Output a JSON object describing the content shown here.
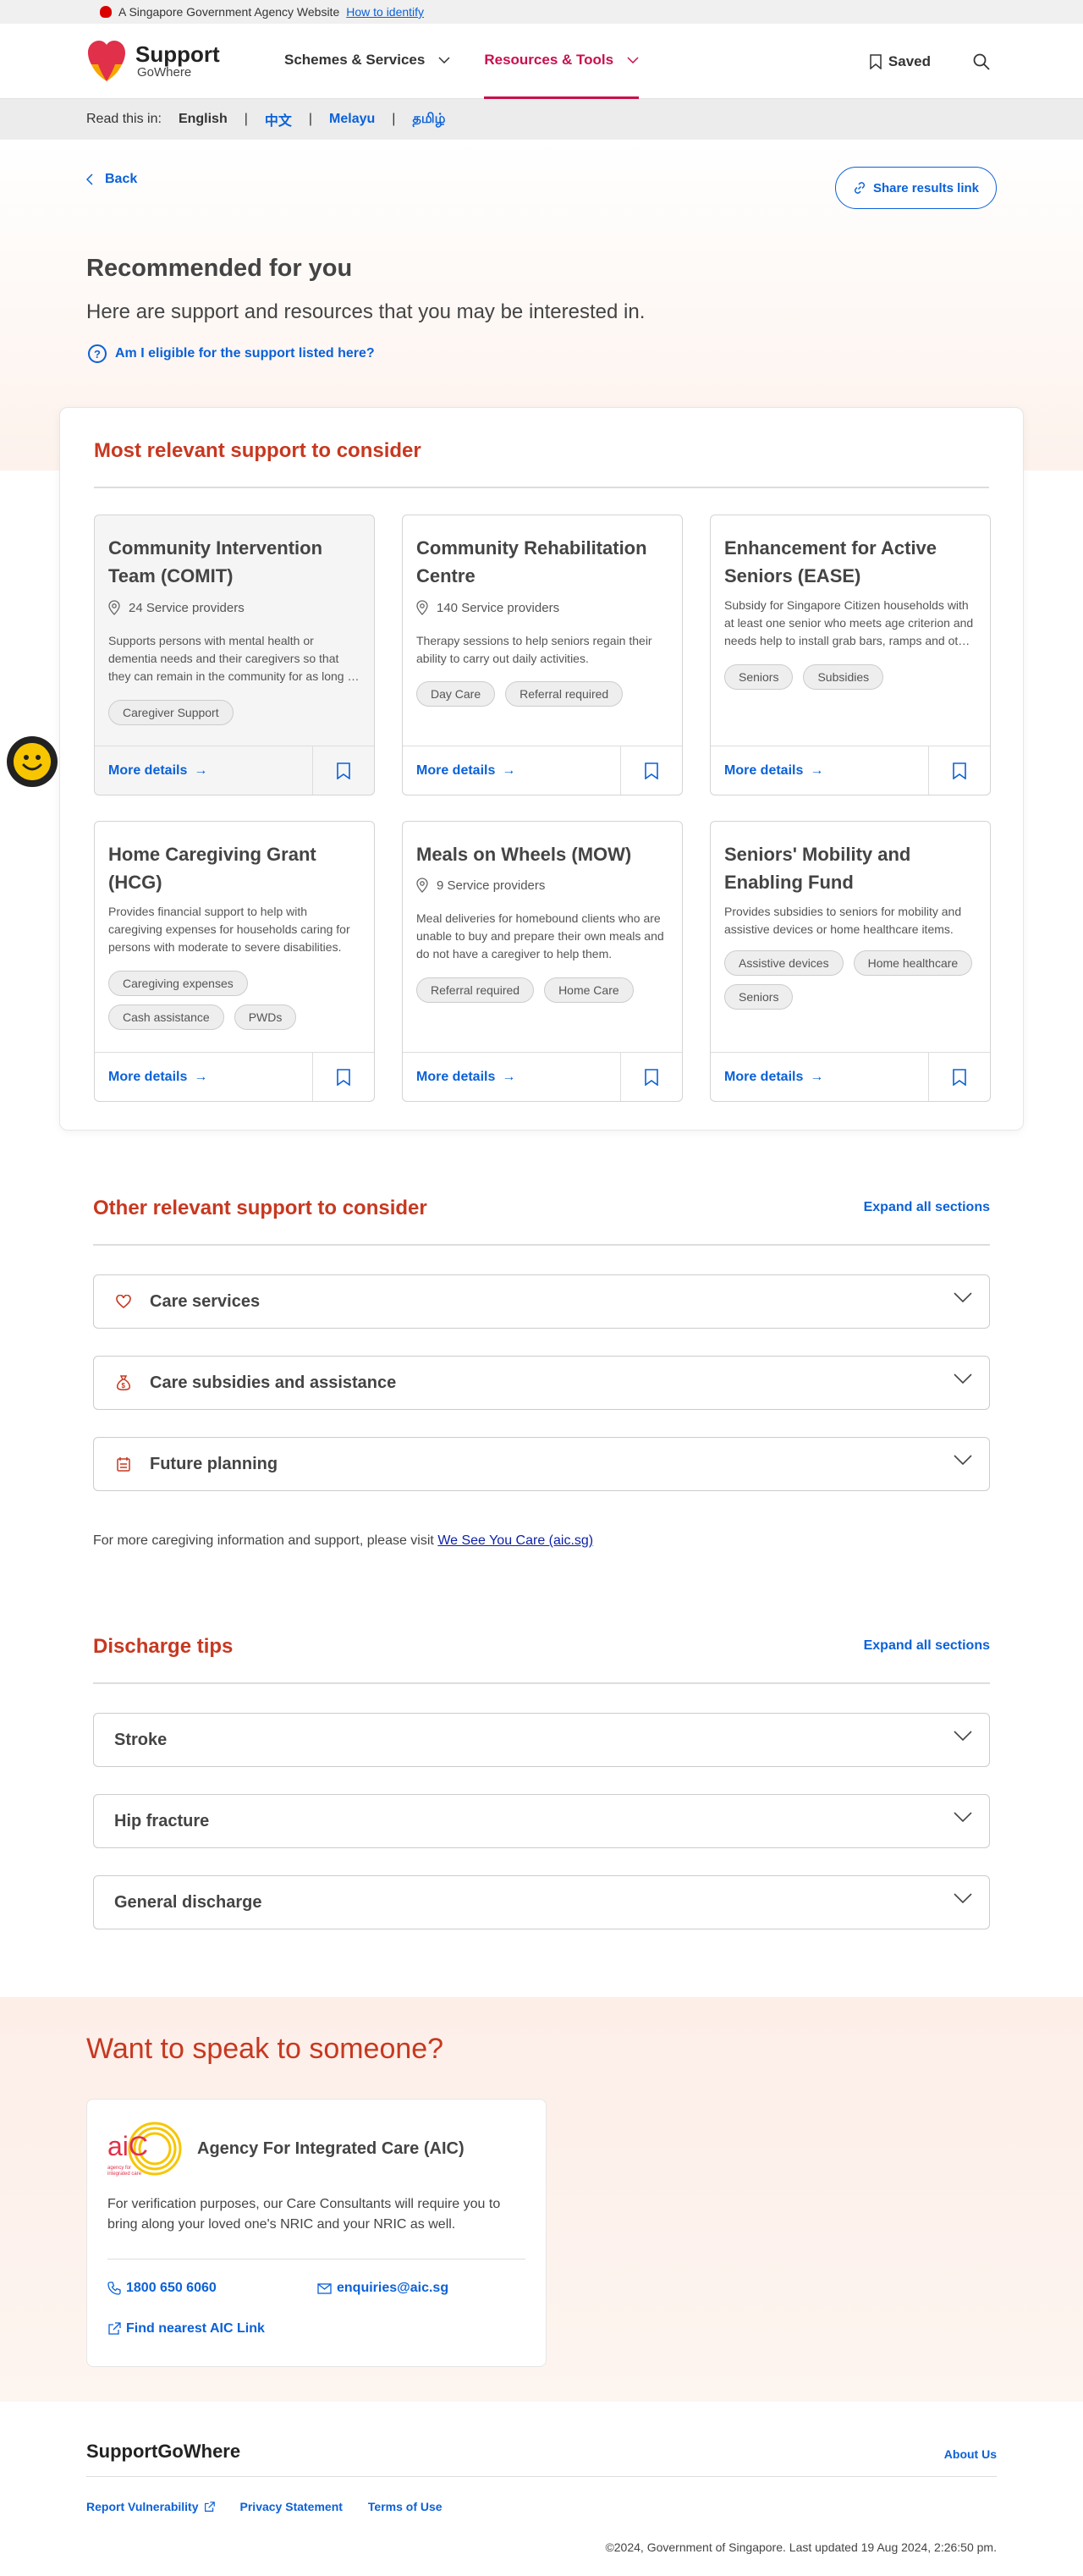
{
  "gov_banner": {
    "text": "A Singapore Government Agency Website",
    "link": "How to identify"
  },
  "logo": {
    "line1": "Support",
    "line2": "GoWhere"
  },
  "nav": [
    {
      "label": "Schemes & Services"
    },
    {
      "label": "Resources & Tools"
    }
  ],
  "header_right": {
    "saved": "Saved"
  },
  "lang": {
    "label": "Read this in:",
    "options": [
      "English",
      "中文",
      "Melayu",
      "தமிழ்"
    ]
  },
  "hero": {
    "back": "Back",
    "share": "Share results link",
    "title": "Recommended for you",
    "subtitle": "Here are support and resources that you may be interested in.",
    "eligibility": "Am I eligible for the support listed here?"
  },
  "most_relevant": {
    "title": "Most relevant support to consider",
    "cards": [
      {
        "title": "Community Intervention Team (COMIT)",
        "providers": "24 Service providers",
        "desc": "Supports persons with mental health or dementia needs and their caregivers so that they can remain in the community for as long as possible.",
        "tags": [
          "Caregiver Support"
        ],
        "more": "More details"
      },
      {
        "title": "Community Rehabilitation Centre",
        "providers": "140 Service providers",
        "desc": "Therapy sessions to help seniors regain their ability to carry out daily activities.",
        "tags": [
          "Day Care",
          "Referral required"
        ],
        "more": "More details"
      },
      {
        "title": "Enhancement for Active Seniors (EASE)",
        "providers": "",
        "desc": "Subsidy for Singapore Citizen households with at least one senior who meets age criterion and needs help to install grab bars, ramps and other home fittings.",
        "tags": [
          "Seniors",
          "Subsidies"
        ],
        "more": "More details"
      },
      {
        "title": "Home Caregiving Grant (HCG)",
        "providers": "",
        "desc": "Provides financial support to help with caregiving expenses for households caring for persons with moderate to severe disabilities.",
        "tags": [
          "Caregiving expenses",
          "Cash assistance",
          "PWDs"
        ],
        "more": "More details"
      },
      {
        "title": "Meals on Wheels (MOW)",
        "providers": "9 Service providers",
        "desc": "Meal deliveries for homebound clients who are unable to buy and prepare their own meals and do not have a caregiver to help them.",
        "tags": [
          "Referral required",
          "Home Care"
        ],
        "more": "More details"
      },
      {
        "title": "Seniors' Mobility and Enabling Fund",
        "providers": "",
        "desc": "Provides subsidies to seniors for mobility and assistive devices or home healthcare items.",
        "tags": [
          "Assistive devices",
          "Home healthcare",
          "Seniors"
        ],
        "more": "More details"
      }
    ]
  },
  "other_relevant": {
    "title": "Other relevant support to consider",
    "expand": "Expand all sections",
    "sections": [
      "Care services",
      "Care subsidies and assistance",
      "Future planning"
    ]
  },
  "visit": {
    "text": "For more caregiving information and support, please visit ",
    "link": "We See You Care (aic.sg)"
  },
  "discharge": {
    "title": "Discharge tips",
    "expand": "Expand all sections",
    "sections": [
      "Stroke",
      "Hip fracture",
      "General discharge"
    ]
  },
  "speak": {
    "title": "Want to speak to someone?",
    "org": "Agency For Integrated Care (AIC)",
    "logo_text": "AIC",
    "logo_sub": "Agency for Integrated Care",
    "note": "For verification purposes, our Care Consultants will require you to bring along your loved one's NRIC and your NRIC as well.",
    "phone": "1800 650 6060",
    "email": "enquiries@aic.sg",
    "find": "Find nearest AIC Link"
  },
  "footer": {
    "brand": "SupportGoWhere",
    "about": "About Us",
    "links": [
      "Report Vulnerability",
      "Privacy Statement",
      "Terms of Use"
    ],
    "copyright": "©2024, Government of Singapore. Last updated 19 Aug 2024, 2:26:50 pm."
  }
}
